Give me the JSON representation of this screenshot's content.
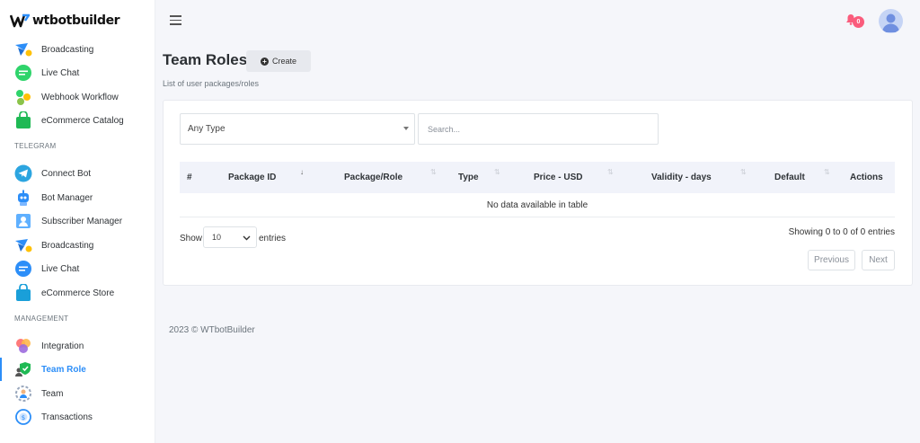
{
  "brand": {
    "name": "wtbotbuilder"
  },
  "sidebar": {
    "top_items": [
      {
        "label": "Broadcasting",
        "icon": "broadcast-icon"
      },
      {
        "label": "Live Chat",
        "icon": "chat-icon"
      },
      {
        "label": "Webhook Workflow",
        "icon": "webhook-icon"
      },
      {
        "label": "eCommerce Catalog",
        "icon": "shopping-bag-icon"
      }
    ],
    "telegram_title": "TELEGRAM",
    "telegram_items": [
      {
        "label": "Connect Bot",
        "icon": "telegram-icon"
      },
      {
        "label": "Bot Manager",
        "icon": "robot-icon"
      },
      {
        "label": "Subscriber Manager",
        "icon": "subscriber-icon"
      },
      {
        "label": "Broadcasting",
        "icon": "broadcast-icon"
      },
      {
        "label": "Live Chat",
        "icon": "chat-icon"
      },
      {
        "label": "eCommerce Store",
        "icon": "shopping-bag-icon"
      }
    ],
    "management_title": "MANAGEMENT",
    "management_items": [
      {
        "label": "Integration",
        "icon": "integration-icon"
      },
      {
        "label": "Team Role",
        "icon": "team-role-icon",
        "active": true
      },
      {
        "label": "Team",
        "icon": "team-icon"
      },
      {
        "label": "Transactions",
        "icon": "transactions-icon"
      }
    ]
  },
  "topbar": {
    "notification_count": "0"
  },
  "header": {
    "title": "Team Roles",
    "create_label": "Create",
    "subtitle": "List of user packages/roles"
  },
  "filters": {
    "type_value": "Any Type",
    "search_placeholder": "Search..."
  },
  "table": {
    "columns": [
      "#",
      "Package ID",
      "Package/Role",
      "Type",
      "Price - USD",
      "Validity - days",
      "Default",
      "Actions"
    ],
    "empty_message": "No data available in table"
  },
  "pagination": {
    "show_label": "Show",
    "page_length": "10",
    "entries_label": "entries",
    "info": "Showing 0 to 0 of 0 entries",
    "previous": "Previous",
    "next": "Next"
  },
  "footer": {
    "text": "2023 © WTbotBuilder"
  },
  "colors": {
    "accent": "#2c8ef8",
    "badge": "#fa5c7c",
    "background": "#f5f6fa"
  }
}
